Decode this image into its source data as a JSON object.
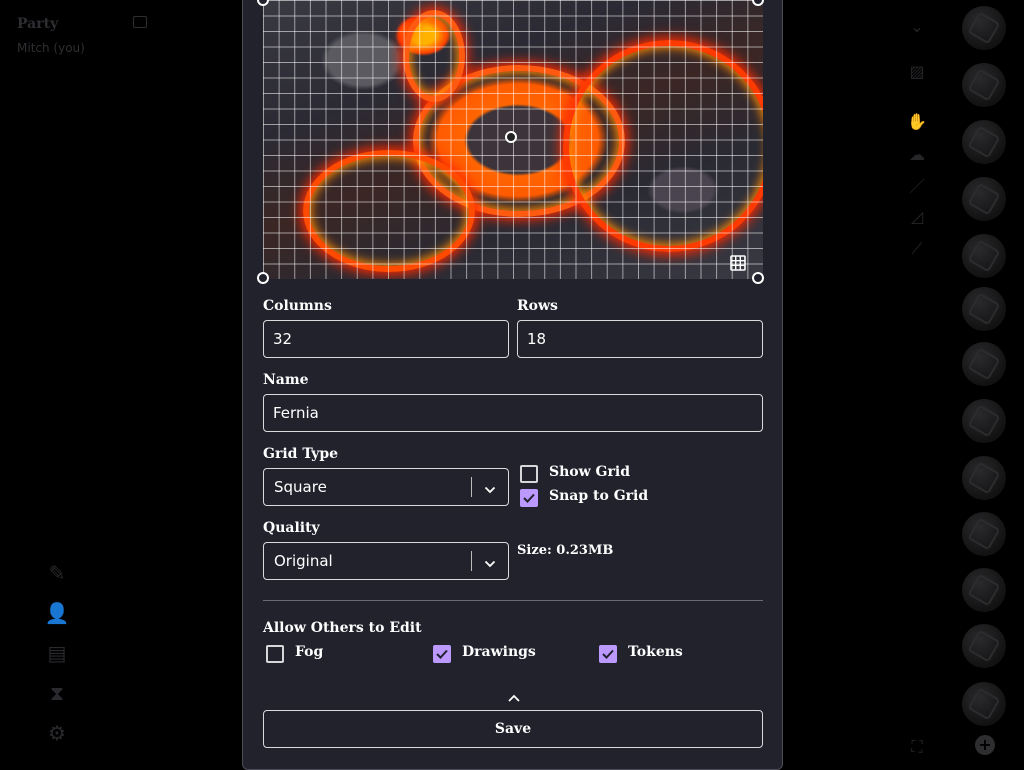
{
  "party": {
    "title": "Party",
    "player": "Mitch (you)"
  },
  "map_settings": {
    "columns_label": "Columns",
    "columns_value": "32",
    "rows_label": "Rows",
    "rows_value": "18",
    "name_label": "Name",
    "name_value": "Fernia",
    "grid_type_label": "Grid Type",
    "grid_type_value": "Square",
    "show_grid_label": "Show Grid",
    "show_grid_checked": false,
    "snap_to_grid_label": "Snap to Grid",
    "snap_to_grid_checked": true,
    "quality_label": "Quality",
    "quality_value": "Original",
    "size_text": "Size: 0.23MB",
    "allow_edit_label": "Allow Others to Edit",
    "permissions": [
      {
        "label": "Fog",
        "checked": false
      },
      {
        "label": "Drawings",
        "checked": true
      },
      {
        "label": "Tokens",
        "checked": true
      }
    ],
    "save_label": "Save"
  },
  "colors": {
    "modal_bg": "#21222c",
    "accent": "#bb99ff",
    "border": "#d9d9de"
  },
  "icons": {
    "grid": "grid-icon",
    "chevron": "chevron-down-icon",
    "collapse": "chevron-up-icon"
  }
}
